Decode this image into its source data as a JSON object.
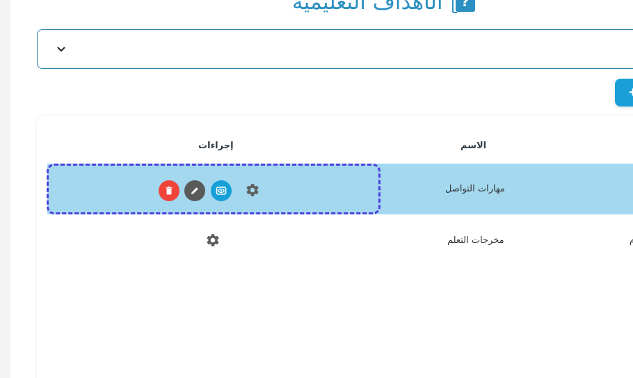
{
  "header": {
    "title": "الأهداف التعليمية",
    "icon": "question-book-icon"
  },
  "select": {
    "value": ""
  },
  "table": {
    "headers": {
      "name": "الاسم",
      "actions": "إجراءات"
    },
    "rows": [
      {
        "name": "مهارات التواصل",
        "selected": true
      },
      {
        "name": "مخرجات التعلم",
        "extra": "م",
        "selected": false
      }
    ]
  },
  "colors": {
    "accent": "#2b8fc2",
    "primary_button": "#1a9fd8",
    "row_highlight": "#a3d8ef",
    "focus_outline": "#4d3fe0",
    "delete": "#f0443b",
    "edit": "#5a5a5a",
    "view": "#169fd8"
  }
}
